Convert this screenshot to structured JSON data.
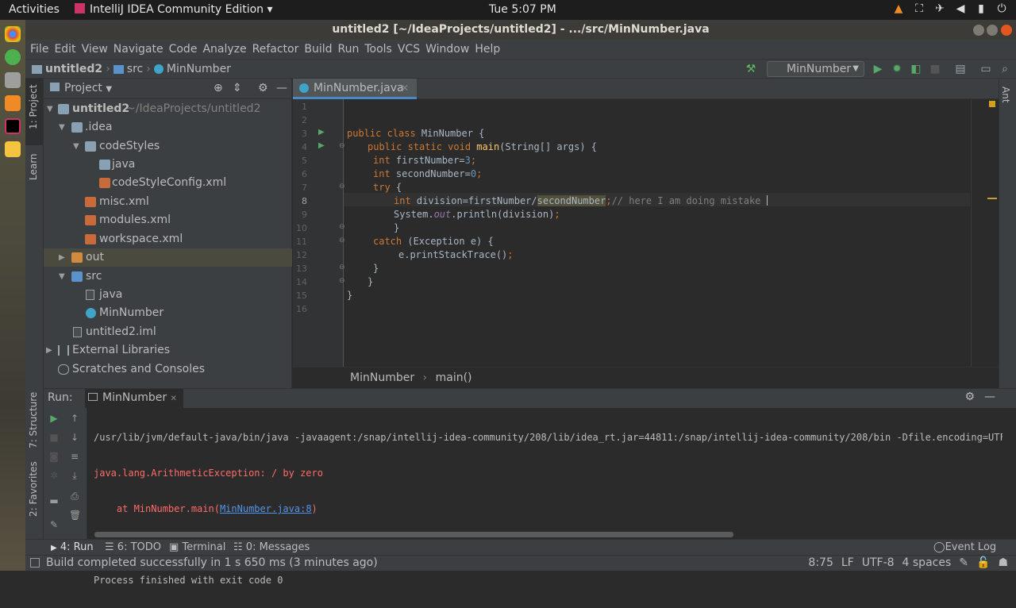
{
  "topbar": {
    "activities": "Activities",
    "app_name": "IntelliJ IDEA Community Edition",
    "clock": "Tue  5:07 PM"
  },
  "window": {
    "title": "untitled2 [~/IdeaProjects/untitled2] - .../src/MinNumber.java"
  },
  "menu": [
    "File",
    "Edit",
    "View",
    "Navigate",
    "Code",
    "Analyze",
    "Refactor",
    "Build",
    "Run",
    "Tools",
    "VCS",
    "Window",
    "Help"
  ],
  "navbar": {
    "crumbs": [
      "untitled2",
      "src",
      "MinNumber"
    ],
    "run_config": "MinNumber"
  },
  "left_tabs": {
    "project": "1: Project",
    "learn": "Learn",
    "structure": "7: Structure",
    "favorites": "2: Favorites"
  },
  "right_tabs": {
    "ant": "Ant"
  },
  "project_panel": {
    "title": "Project",
    "tree": [
      {
        "label": "untitled2",
        "hint": "~/IdeaProjects/untitled2"
      },
      {
        "label": ".idea"
      },
      {
        "label": "codeStyles"
      },
      {
        "label": "java"
      },
      {
        "label": "codeStyleConfig.xml"
      },
      {
        "label": "misc.xml"
      },
      {
        "label": "modules.xml"
      },
      {
        "label": "workspace.xml"
      },
      {
        "label": "out"
      },
      {
        "label": "src"
      },
      {
        "label": "java"
      },
      {
        "label": "MinNumber"
      },
      {
        "label": "untitled2.iml"
      },
      {
        "label": "External Libraries"
      },
      {
        "label": "Scratches and Consoles"
      }
    ]
  },
  "editor": {
    "tab": "MinNumber.java",
    "line_numbers": [
      "1",
      "2",
      "3",
      "4",
      "5",
      "6",
      "7",
      "8",
      "9",
      "10",
      "11",
      "12",
      "13",
      "14",
      "15",
      "16"
    ],
    "breadcrumb": [
      "MinNumber",
      "main()"
    ],
    "code": {
      "l3_kw": "public class ",
      "l3_name": "MinNumber {",
      "l4_kw": "public static void ",
      "l4_fn": "main",
      "l4_rest": "(String[] args) {",
      "l5_kw": "int ",
      "l5_var": "firstNumber=",
      "l5_num": "3",
      "l5_end": ";",
      "l6_kw": "int ",
      "l6_var": "secondNumber=",
      "l6_num": "0",
      "l6_end": ";",
      "l7_kw": "try",
      "l7_rest": " {",
      "l8_kw": "int ",
      "l8_expr": "division=firstNumber/",
      "l8_hl": "secondNumber",
      "l8_end": ";",
      "l8_cmt": "// here I am doing mistake ",
      "l9_a": "System.",
      "l9_out": "out",
      "l9_b": ".println(division)",
      "l9_end": ";",
      "l10": "}",
      "l11_kw": "catch",
      "l11_rest": " (Exception e) {",
      "l12": "e.printStackTrace()",
      "l12_end": ";",
      "l13": "}",
      "l14": "}",
      "l15": "}"
    }
  },
  "run_panel": {
    "label": "Run:",
    "tab": "MinNumber",
    "cmd": "/usr/lib/jvm/default-java/bin/java -javaagent:/snap/intellij-idea-community/208/lib/idea_rt.jar=44811:/snap/intellij-idea-community/208/bin -Dfile.encoding=UTF-8 -classpath /",
    "exception": "java.lang.ArithmeticException: / by zero",
    "at_prefix": "    at MinNumber.main(",
    "at_link": "MinNumber.java:8",
    "at_suffix": ")",
    "exit": "Process finished with exit code 0"
  },
  "bottom_tabs": {
    "run": "4: Run",
    "todo": "6: TODO",
    "terminal": "Terminal",
    "messages": "0: Messages",
    "event_log": "Event Log"
  },
  "status": {
    "message": "Build completed successfully in 1 s 650 ms (3 minutes ago)",
    "position": "8:75",
    "line_sep": "LF",
    "encoding": "UTF-8",
    "indent": "4 spaces"
  }
}
